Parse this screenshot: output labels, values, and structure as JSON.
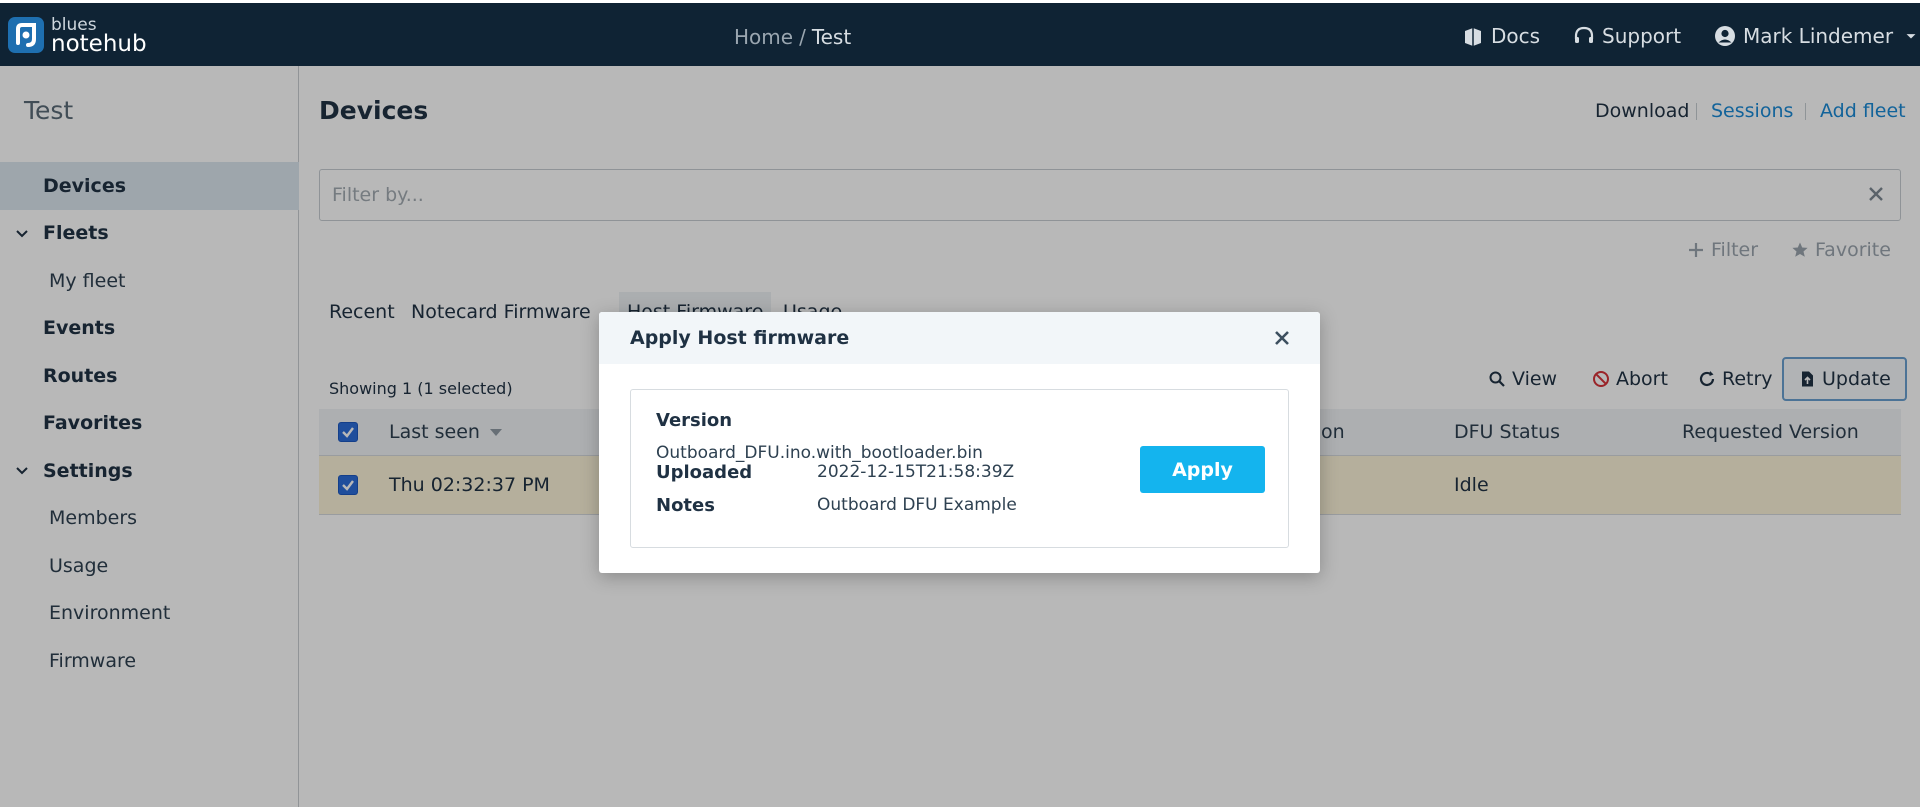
{
  "topbar": {
    "logo_line1": "blues",
    "logo_line2": "notehub",
    "breadcrumb": {
      "home": "Home",
      "separator": "/",
      "current": "Test"
    },
    "docs": "Docs",
    "support": "Support",
    "user": "Mark Lindemer"
  },
  "sidebar": {
    "project": "Test",
    "items": [
      {
        "label": "Devices"
      },
      {
        "label": "Fleets"
      },
      {
        "label": "My fleet"
      },
      {
        "label": "Events"
      },
      {
        "label": "Routes"
      },
      {
        "label": "Favorites"
      },
      {
        "label": "Settings"
      },
      {
        "label": "Members"
      },
      {
        "label": "Usage"
      },
      {
        "label": "Environment"
      },
      {
        "label": "Firmware"
      }
    ]
  },
  "main": {
    "title": "Devices",
    "links": {
      "download": "Download",
      "sessions": "Sessions",
      "add_fleet": "Add fleet"
    },
    "filter": {
      "placeholder": "Filter by..."
    },
    "tools": {
      "filter": "Filter",
      "favorite": "Favorite"
    },
    "tabs": [
      "Recent",
      "Notecard Firmware",
      "Host Firmware",
      "Usage"
    ],
    "showing": "Showing 1 (1 selected)",
    "actions": {
      "view": "View",
      "abort": "Abort",
      "retry": "Retry",
      "update": "Update"
    },
    "table": {
      "columns": [
        "Last seen",
        "on",
        "DFU Status",
        "Requested Version"
      ],
      "rows": [
        {
          "last_seen": "Thu 02:32:37 PM",
          "dfu_status": "Idle",
          "requested_version": ""
        }
      ]
    }
  },
  "modal": {
    "title": "Apply Host firmware",
    "version_label": "Version",
    "version_value": "Outboard_DFU.ino.with_bootloader.bin",
    "uploaded_label": "Uploaded",
    "uploaded_value": "2022-12-15T21:58:39Z",
    "notes_label": "Notes",
    "notes_value": "Outboard DFU Example",
    "apply": "Apply"
  },
  "colors": {
    "topbar_bg": "#0f2334",
    "accent": "#1a8ad6",
    "apply_button": "#14b4ee",
    "selected_row": "#fbf3d8",
    "abort_icon": "#d6333a"
  }
}
